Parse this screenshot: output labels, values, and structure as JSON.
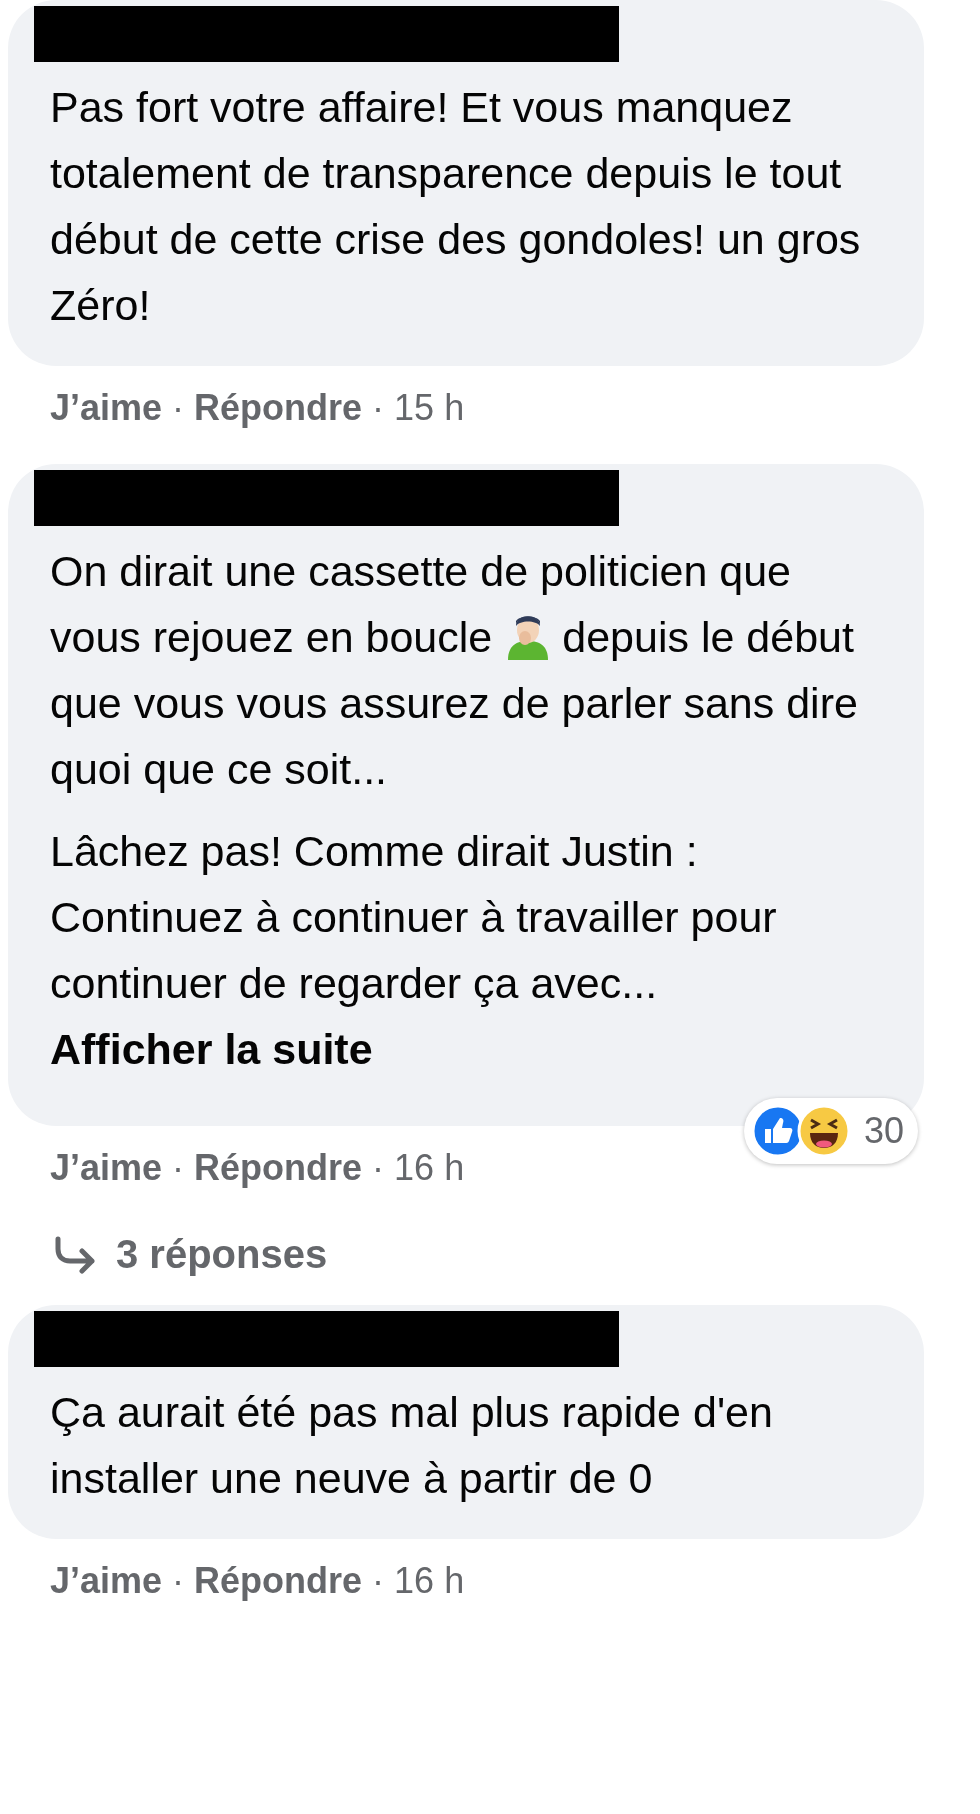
{
  "comments": [
    {
      "author_redacted": true,
      "paragraphs": [
        [
          {
            "kind": "text",
            "text": "Pas fort votre affaire! Et vous manquez totalement de transparence depuis le tout début de cette crise des gondoles! un gros Zéro!"
          }
        ]
      ],
      "actions": [
        "J’aime",
        "Répondre"
      ],
      "separator": "·",
      "time": "15 h"
    },
    {
      "author_redacted": true,
      "paragraphs": [
        [
          {
            "kind": "text",
            "text": "On dirait une cassette de politicien que vous rejouez en boucle"
          },
          {
            "kind": "emoji"
          },
          {
            "kind": "text",
            "text": "depuis le début que vous vous assurez de parler sans dire quoi que ce soit..."
          }
        ],
        [
          {
            "kind": "text",
            "text": "Lâchez pas! Comme dirait Justin : Continuez à continuer à travailler pour continuer de regarder ça avec..."
          },
          {
            "kind": "link",
            "text": "Afficher la suite"
          }
        ]
      ],
      "reactions": {
        "count": "30"
      },
      "actions": [
        "J’aime",
        "Répondre"
      ],
      "separator": "·",
      "time": "16 h",
      "replies": "3 réponses"
    },
    {
      "author_redacted": true,
      "paragraphs": [
        [
          {
            "kind": "text",
            "text": "Ça aurait été pas mal plus rapide d'en installer une neuve à partir de 0"
          }
        ]
      ],
      "actions": [
        "J’aime",
        "Répondre"
      ],
      "separator": "·",
      "time": "16 h"
    }
  ]
}
